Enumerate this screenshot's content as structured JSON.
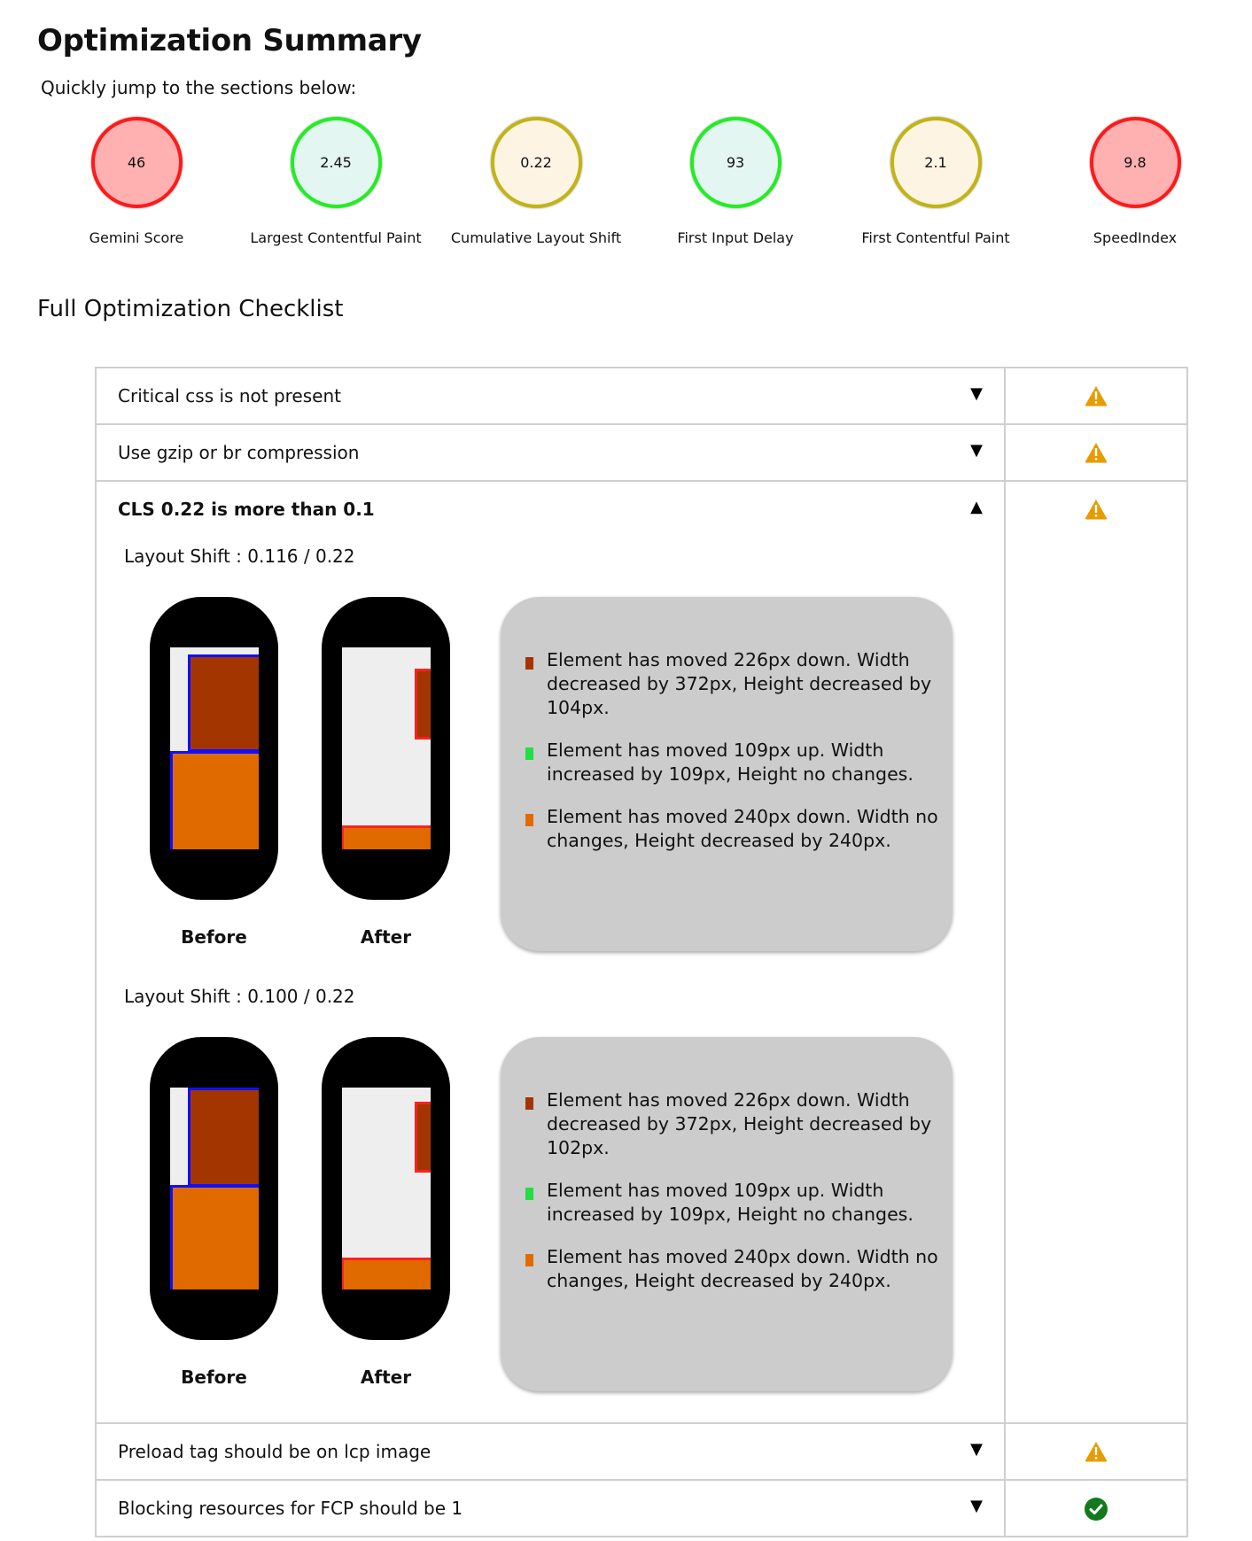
{
  "header": {
    "title": "Optimization Summary",
    "jump_text": "Quickly jump to the sections below:"
  },
  "metrics": [
    {
      "label": "Gemini Score",
      "value": "46",
      "status": "poor",
      "border": "#ff1a1a",
      "fill": "#ffb0b0"
    },
    {
      "label": "Largest Contentful Paint",
      "value": "2.45",
      "status": "good",
      "border": "#22ee22",
      "fill": "#e3f6f1"
    },
    {
      "label": "Cumulative Layout Shift",
      "value": "0.22",
      "status": "average",
      "border": "#c2b413",
      "fill": "#fdf4e4"
    },
    {
      "label": "First Input Delay",
      "value": "93",
      "status": "good",
      "border": "#22ee22",
      "fill": "#e3f6f1"
    },
    {
      "label": "First Contentful Paint",
      "value": "2.1",
      "status": "average",
      "border": "#c2b413",
      "fill": "#fdf4e4"
    },
    {
      "label": "SpeedIndex",
      "value": "9.8",
      "status": "poor",
      "border": "#ff1a1a",
      "fill": "#ffb0b0"
    }
  ],
  "checklist": {
    "title": "Full Optimization Checklist",
    "items": [
      {
        "label": "Critical css is not present",
        "expanded": false,
        "caret": "▼",
        "status": "warning-icon"
      },
      {
        "label": "Use gzip or br compression",
        "expanded": false,
        "caret": "▼",
        "status": "warning-icon"
      },
      {
        "label": "CLS 0.22 is more than 0.1",
        "expanded": true,
        "caret": "▲",
        "status": "warning-icon",
        "shifts": [
          {
            "title": "Layout Shift : 0.116 / 0.22",
            "before_label": "Before",
            "after_label": "After",
            "changes": [
              {
                "color": "#a33500",
                "text": "Element has moved 226px down. Width decreased by 372px, Height decreased by 104px."
              },
              {
                "color": "#22dd44",
                "text": "Element has moved 109px up. Width increased by 109px, Height no changes."
              },
              {
                "color": "#e06a00",
                "text": "Element has moved 240px down. Width no changes, Height decreased by 240px."
              }
            ]
          },
          {
            "title": "Layout Shift : 0.100 / 0.22",
            "before_label": "Before",
            "after_label": "After",
            "changes": [
              {
                "color": "#a33500",
                "text": "Element has moved 226px down. Width decreased by 372px, Height decreased by 102px."
              },
              {
                "color": "#22dd44",
                "text": "Element has moved 109px up. Width increased by 109px, Height no changes."
              },
              {
                "color": "#e06a00",
                "text": "Element has moved 240px down. Width no changes, Height decreased by 240px."
              }
            ]
          }
        ]
      },
      {
        "label": "Preload tag should be on lcp image",
        "expanded": false,
        "caret": "▼",
        "status": "warning-icon"
      },
      {
        "label": "Blocking resources for FCP should be 1",
        "expanded": false,
        "caret": "▼",
        "status": "check-icon"
      }
    ]
  },
  "colors": {
    "warning": "#e69c00",
    "success": "#127a1c",
    "before_outline": "#1010ff",
    "after_outline": "#ff2020",
    "element_dark": "#a33500",
    "element_orange": "#e06a00"
  }
}
